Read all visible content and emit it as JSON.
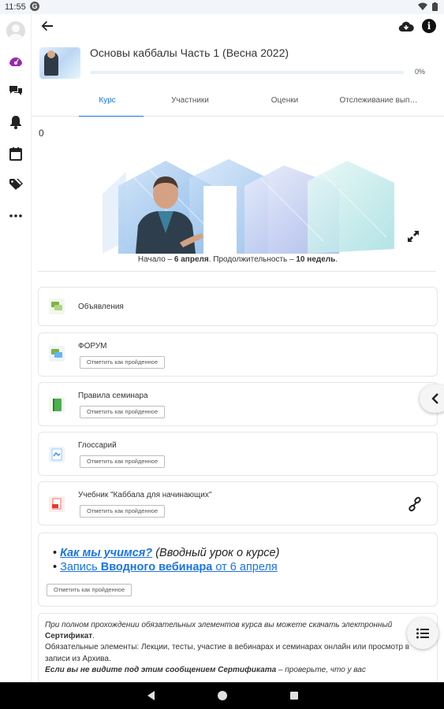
{
  "status_bar": {
    "time": "11:55",
    "g_badge": "G"
  },
  "header": {
    "back_label": "back",
    "cloud_label": "download",
    "info_label": "i"
  },
  "course": {
    "title": "Основы каббалы Часть 1 (Весна 2022)",
    "progress_text": "0%",
    "progress_fraction": 0
  },
  "tabs": [
    {
      "label": "Курс",
      "active": true
    },
    {
      "label": "Участники",
      "active": false
    },
    {
      "label": "Оценки",
      "active": false
    },
    {
      "label": "Отслеживание вып…",
      "active": false
    }
  ],
  "section": {
    "number": "0",
    "banner_caption": {
      "start_prefix": "Начало – ",
      "start_date": "6 апреля",
      "duration_prefix": ". Продолжительность – ",
      "duration": "10 недель",
      "suffix": "."
    }
  },
  "activities": [
    {
      "name": "Объявления",
      "icon": "announcements-icon"
    },
    {
      "name": "ФОРУМ",
      "icon": "forum-icon",
      "button": "Отметить как пройденное"
    },
    {
      "name": "Правила семинара",
      "icon": "book-icon",
      "button": "Отметить как пройденное"
    },
    {
      "name": "Глоссарий",
      "icon": "glossary-icon",
      "button": "Отметить как пройденное"
    },
    {
      "name": "Учебник \"Каббала для начинающих\"",
      "icon": "pdf-icon",
      "button": "Отметить как пройденное"
    }
  ],
  "lesson_label": {
    "line1_link": "Как мы учимся?",
    "line1_rest": " (Вводный урок о курсе)",
    "line2_link_a": "Запись ",
    "line2_link_b": "Вводного вебинара",
    "line2_link_c": " от 6 апреля",
    "button": "Отметить как пройденное"
  },
  "notice": {
    "p1": "При полном прохождении обязательных элементов курса вы можете скачать электронный ",
    "p1_bold": "Сертификат",
    "p1_end": ".",
    "p2": "Обязательные элементы: Лекции, тесты, участие в вебинарах и семинарах онлайн или просмотр в записи из Архива.",
    "p3_bold": "Если вы не видите под этим сообщением Сертификата",
    "p3_rest": " – проверьте, что у вас"
  },
  "colors": {
    "accent": "#1a73e8",
    "rail_active": "#9c27b0"
  }
}
